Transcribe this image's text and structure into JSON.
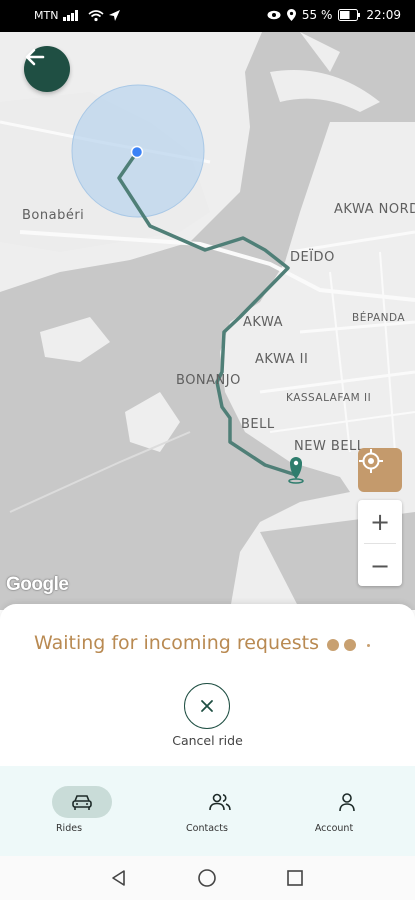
{
  "status_bar": {
    "carrier": "MTN",
    "battery": "55 %",
    "time": "22:09"
  },
  "map": {
    "labels": {
      "bonaberi": "Bonabéri",
      "akwa_nord": "AKWA NORD",
      "deido": "DEÏDO",
      "bepanda": "BÉPANDA",
      "akwa": "AKWA",
      "akwa_ii": "AKWA II",
      "bonanjo": "BONANJO",
      "kassalafam_ii": "KASSALAFAM II",
      "bell": "BELL",
      "new_bell": "NEW BELL"
    },
    "attribution": "Google",
    "zoom_in": "+",
    "zoom_out": "−",
    "colors": {
      "route": "#4f7f77",
      "pickup": "#3b82f6",
      "accuracy": "#bcd6ee"
    }
  },
  "sheet": {
    "status_text": "Waiting for incoming requests",
    "cancel_label": "Cancel ride",
    "accent": "#b98a52"
  },
  "tabs": [
    {
      "label": "Rides",
      "icon": "car-icon",
      "active": true
    },
    {
      "label": "Contacts",
      "icon": "contacts-icon",
      "active": false
    },
    {
      "label": "Account",
      "icon": "person-icon",
      "active": false
    }
  ],
  "nav": {
    "back": "back-triangle-icon",
    "home": "home-circle-icon",
    "recents": "recents-square-icon"
  },
  "brand_color": "#1f4f43"
}
